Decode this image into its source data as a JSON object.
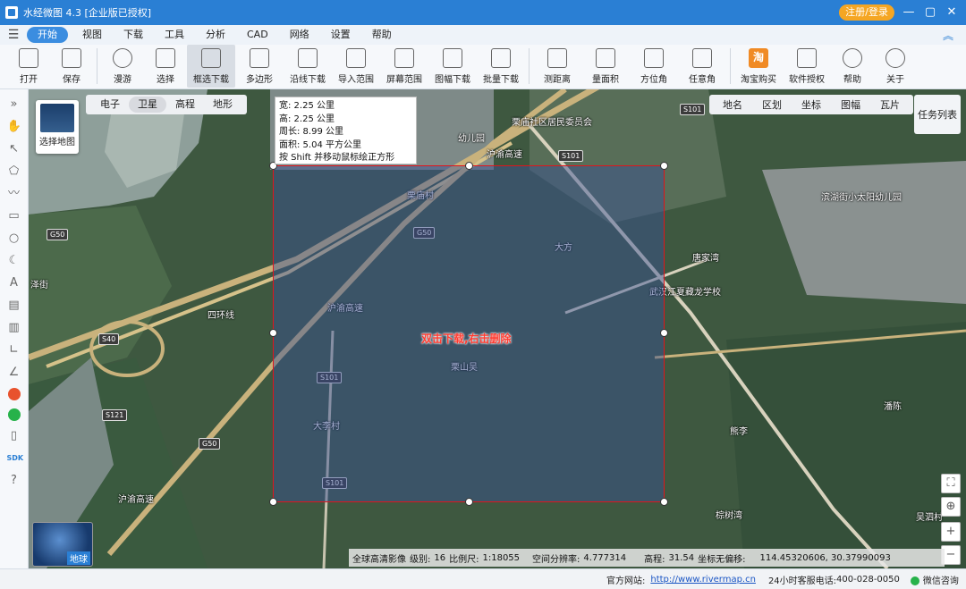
{
  "window": {
    "title": "水经微图 4.3 [企业版已授权]",
    "login_label": "注册/登录",
    "controls": [
      "—",
      "▢",
      "✕"
    ]
  },
  "menu": {
    "items": [
      {
        "label": "开始",
        "active": true
      },
      {
        "label": "视图"
      },
      {
        "label": "下载"
      },
      {
        "label": "工具"
      },
      {
        "label": "分析"
      },
      {
        "label": "CAD"
      },
      {
        "label": "网络"
      },
      {
        "label": "设置"
      },
      {
        "label": "帮助"
      }
    ]
  },
  "toolbar": {
    "open": "打开",
    "save": "保存",
    "roam": "漫游",
    "select": "选择",
    "box_download": "框选下载",
    "polygon": "多边形",
    "line_download": "沿线下载",
    "import_range": "导入范围",
    "screen_range": "屏幕范围",
    "sheet_download": "图幅下载",
    "batch_download": "批量下载",
    "measure_distance": "测距离",
    "measure_area": "量面积",
    "azimuth": "方位角",
    "any_angle": "任意角",
    "taobao": "淘宝购买",
    "license": "软件授权",
    "help": "帮助",
    "about": "关于"
  },
  "map": {
    "layer_select_label": "选择地图",
    "map_types": [
      {
        "label": "电子"
      },
      {
        "label": "卫星",
        "active": true
      },
      {
        "label": "高程"
      },
      {
        "label": "地形"
      }
    ],
    "overlay_layers": [
      "地名",
      "区划",
      "坐标",
      "图幅",
      "瓦片"
    ],
    "task_list": "任务列表",
    "measure_info": {
      "width": "宽: 2.25 公里",
      "height": "高: 2.25 公里",
      "perimeter": "周长: 8.99 公里",
      "area": "面积: 5.04 平方公里",
      "hint": "按 Shift 并移动鼠标绘正方形"
    },
    "selection_hint": "双击下载,右击删除",
    "globe_label": "地球",
    "labels": {
      "li_miao_she_qu": "栗庙社区居民委员会",
      "li_miao_cun": "栗庙村",
      "da_fang": "大方",
      "tang_jia_wan": "唐家湾",
      "yu_nan_ling": "武汉江夏藏龙学校",
      "li_shan_wu": "栗山吴",
      "da_li_cun": "大李村",
      "bin_hu": "滨湖街小太阳幼儿园",
      "huan_xian": "四环线",
      "hu_yu_gao_su_1": "沪渝高速",
      "hu_yu_gao_su_2": "沪渝高速",
      "hu_yu_gao_su_3": "沪渝高速",
      "kindergarten": "幼儿园",
      "xiong_li": "熊李",
      "zhi_shu_wan": "棕树湾",
      "wu_si_cun": "吴泗村",
      "liu_li": "潘陈",
      "hu_ze": "泽街"
    },
    "road_shields": [
      "S101",
      "S101",
      "G50",
      "G50",
      "S40",
      "S121",
      "S101",
      "G50",
      "S101"
    ],
    "scale": {
      "source": "全球高清影像",
      "level_label": "级别:",
      "level": "16",
      "ratio_label": "比例尺:",
      "ratio": "1:18055",
      "resolution_label": "空间分辨率:",
      "resolution": "4.777314",
      "elevation_label": "高程:",
      "elevation": "31.54",
      "offset_label": "坐标无偏移:",
      "coords": "114.45320606, 30.37990093"
    }
  },
  "statusbar": {
    "site_label": "官方网站:",
    "site_url": "http://www.rivermap.cn",
    "phone_label": "24小时客服电话:",
    "phone": "400-028-0050",
    "wechat": "微信咨询"
  },
  "colors": {
    "title_bar": "#2a7fd4",
    "accent": "#3b8de0",
    "selection_border": "#e0141c",
    "selection_hint": "#ff3b30",
    "login_button": "#f5a623"
  }
}
